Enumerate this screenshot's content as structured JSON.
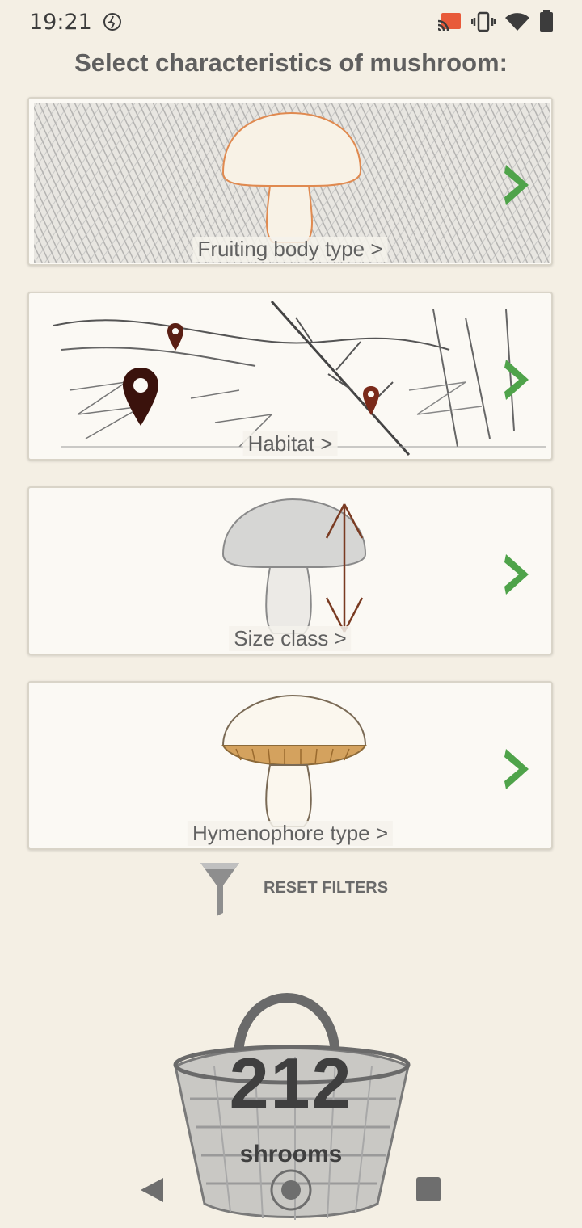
{
  "status_bar": {
    "time": "19:21",
    "icons": [
      "activity-icon",
      "cast-icon",
      "vibrate-icon",
      "wifi-icon",
      "battery-icon"
    ]
  },
  "header": {
    "title": "Select characteristics of mushroom:"
  },
  "cards": [
    {
      "label": "Fruiting body type >",
      "icon": "mushroom-outline-icon"
    },
    {
      "label": "Habitat >",
      "icon": "map-pin-icon"
    },
    {
      "label": "Size class >",
      "icon": "size-arrow-icon"
    },
    {
      "label": "Hymenophore type >",
      "icon": "mushroom-gills-icon"
    }
  ],
  "reset": {
    "label": "RESET FILTERS",
    "icon": "funnel-icon"
  },
  "result": {
    "count": "212",
    "unit": "shrooms",
    "icon": "basket-icon"
  },
  "navigation": {
    "buttons": [
      "back-icon",
      "home-icon",
      "recents-icon"
    ]
  },
  "colors": {
    "background": "#f4efe4",
    "chevron": "#4fa34a",
    "pin": "#5a1f14"
  }
}
